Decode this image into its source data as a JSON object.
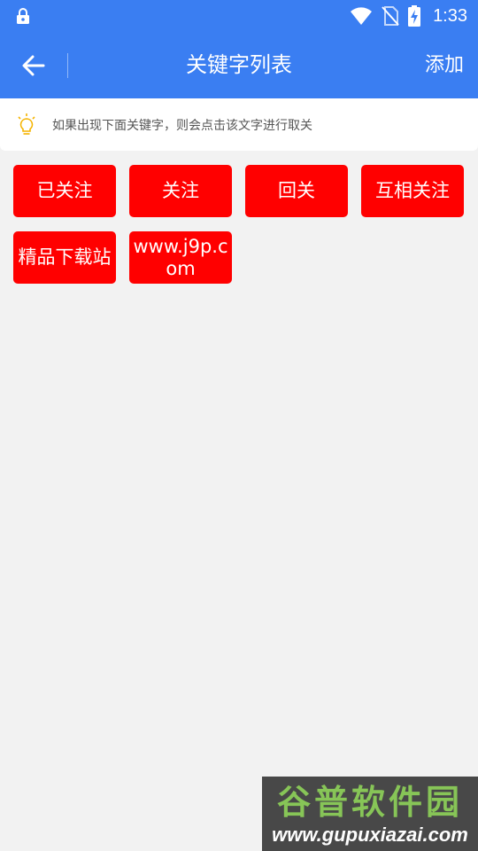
{
  "status_bar": {
    "time": "1:33",
    "icons": [
      "lock-icon",
      "wifi-icon",
      "no-sim-icon",
      "battery-charging-icon"
    ]
  },
  "toolbar": {
    "title": "关键字列表",
    "add_label": "添加",
    "back_icon": "arrow-left-icon"
  },
  "notice": {
    "icon": "lightbulb-icon",
    "text": "如果出现下面关键字，则会点击该文字进行取关"
  },
  "keywords": [
    "已关注",
    "关注",
    "回关",
    "互相关注",
    "精品下载站",
    "www.j9p.com"
  ],
  "watermark": {
    "logo": "谷普软件园",
    "url": "www.gupuxiazai.com"
  },
  "colors": {
    "primary": "#3a7ef2",
    "keyword_bg": "#ff0000",
    "background": "#f2f2f2",
    "bulb": "#f5b400"
  }
}
